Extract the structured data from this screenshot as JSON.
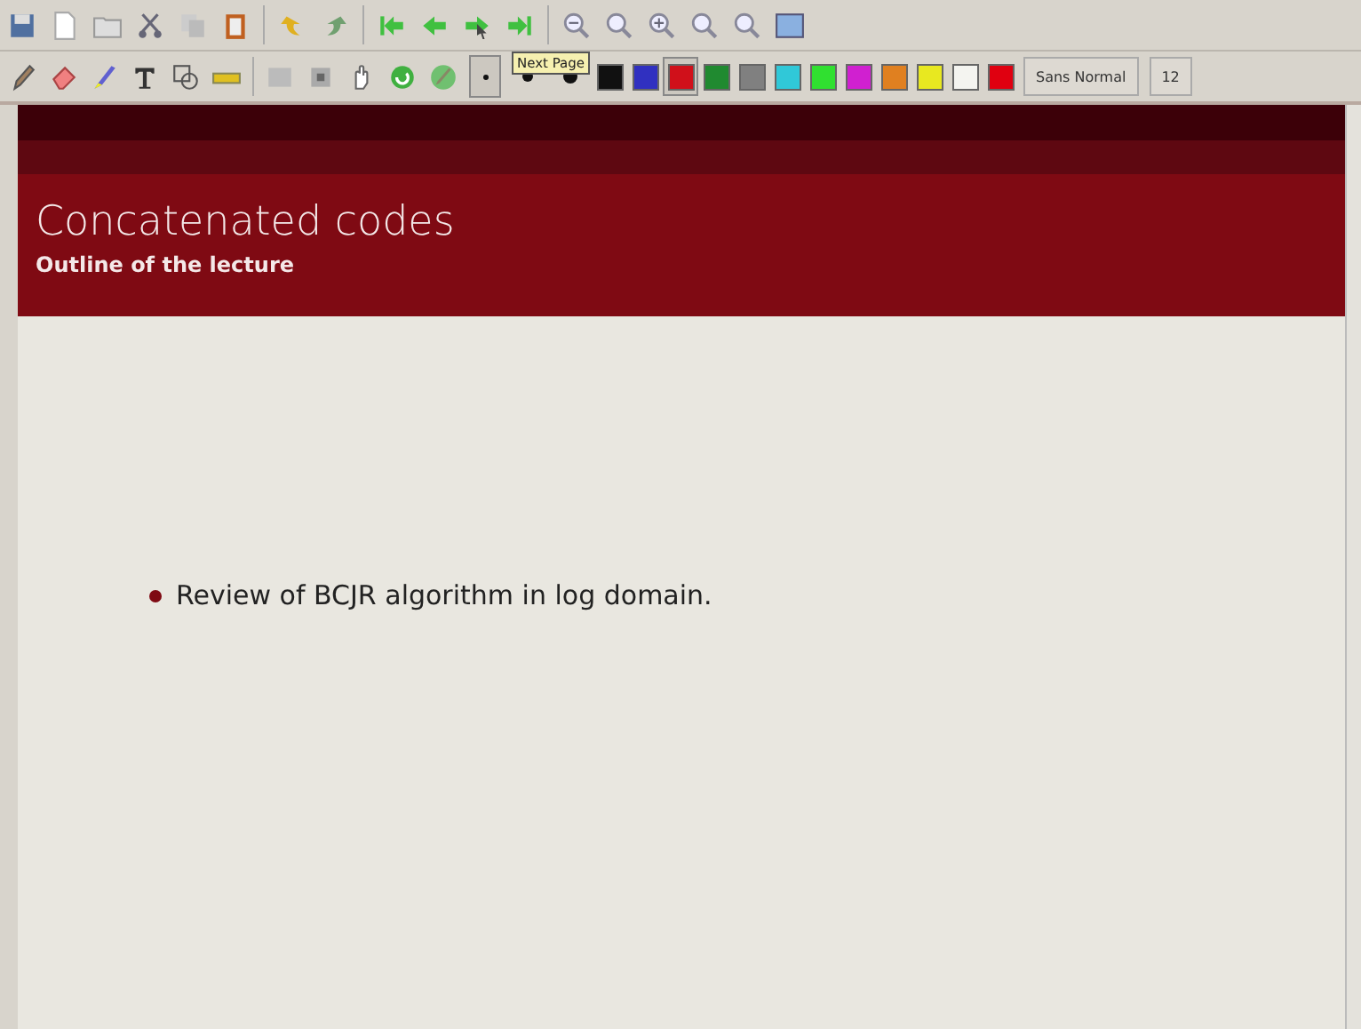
{
  "tooltip": {
    "text": "Next Page"
  },
  "toolbar": {
    "pen_sizes": [
      {
        "selected": true
      },
      {
        "selected": false
      },
      {
        "selected": false
      }
    ],
    "colors": [
      {
        "color": "#111111",
        "selected": false
      },
      {
        "color": "#3030c0",
        "selected": false
      },
      {
        "color": "#d0101a",
        "selected": true
      },
      {
        "color": "#208a30",
        "selected": false
      },
      {
        "color": "#808080",
        "selected": false
      },
      {
        "color": "#30c8d8",
        "selected": false
      },
      {
        "color": "#30e030",
        "selected": false
      },
      {
        "color": "#d020d0",
        "selected": false
      },
      {
        "color": "#e08020",
        "selected": false
      },
      {
        "color": "#e8e820",
        "selected": false
      },
      {
        "color": "#f4f4f0",
        "selected": false
      },
      {
        "color": "#e00010",
        "selected": false
      }
    ],
    "font": "Sans Normal",
    "font_size": "12"
  },
  "slide": {
    "title": "Concatenated codes",
    "subtitle": "Outline of the lecture",
    "bullets": [
      "Review of BCJR algorithm in log domain."
    ]
  }
}
